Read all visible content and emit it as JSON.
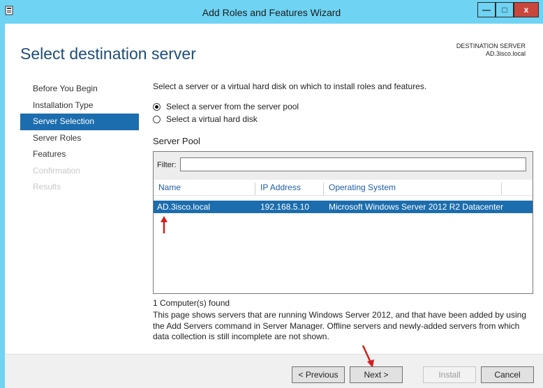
{
  "window": {
    "title": "Add Roles and Features Wizard",
    "minimize_glyph": "—",
    "maximize_glyph": "□",
    "close_glyph": "x"
  },
  "page": {
    "title": "Select destination server",
    "destination_label": "DESTINATION SERVER",
    "destination_value": "AD.3isco.local"
  },
  "nav": {
    "items": [
      {
        "label": "Before You Begin",
        "state": "normal"
      },
      {
        "label": "Installation Type",
        "state": "normal"
      },
      {
        "label": "Server Selection",
        "state": "active"
      },
      {
        "label": "Server Roles",
        "state": "normal"
      },
      {
        "label": "Features",
        "state": "normal"
      },
      {
        "label": "Confirmation",
        "state": "disabled"
      },
      {
        "label": "Results",
        "state": "disabled"
      }
    ]
  },
  "main": {
    "intro": "Select a server or a virtual hard disk on which to install roles and features.",
    "options": [
      {
        "label": "Select a server from the server pool",
        "selected": true
      },
      {
        "label": "Select a virtual hard disk",
        "selected": false
      }
    ],
    "pool_label": "Server Pool",
    "filter_label": "Filter:",
    "filter_value": "",
    "columns": [
      "Name",
      "IP Address",
      "Operating System"
    ],
    "rows": [
      {
        "name": "AD.3isco.local",
        "ip": "192.168.5.10",
        "os": "Microsoft Windows Server 2012 R2 Datacenter"
      }
    ],
    "count_text": "1 Computer(s) found",
    "note": "This page shows servers that are running Windows Server 2012, and that have been added by using the Add Servers command in Server Manager. Offline servers and newly-added servers from which data collection is still incomplete are not shown."
  },
  "footer": {
    "previous": "< Previous",
    "next": "Next >",
    "install": "Install",
    "cancel": "Cancel"
  },
  "colors": {
    "titlebar": "#6fd3f3",
    "selection": "#1c6dad",
    "title_text": "#1e4d78",
    "arrow": "#d11f1f",
    "close_button": "#c9463d"
  }
}
